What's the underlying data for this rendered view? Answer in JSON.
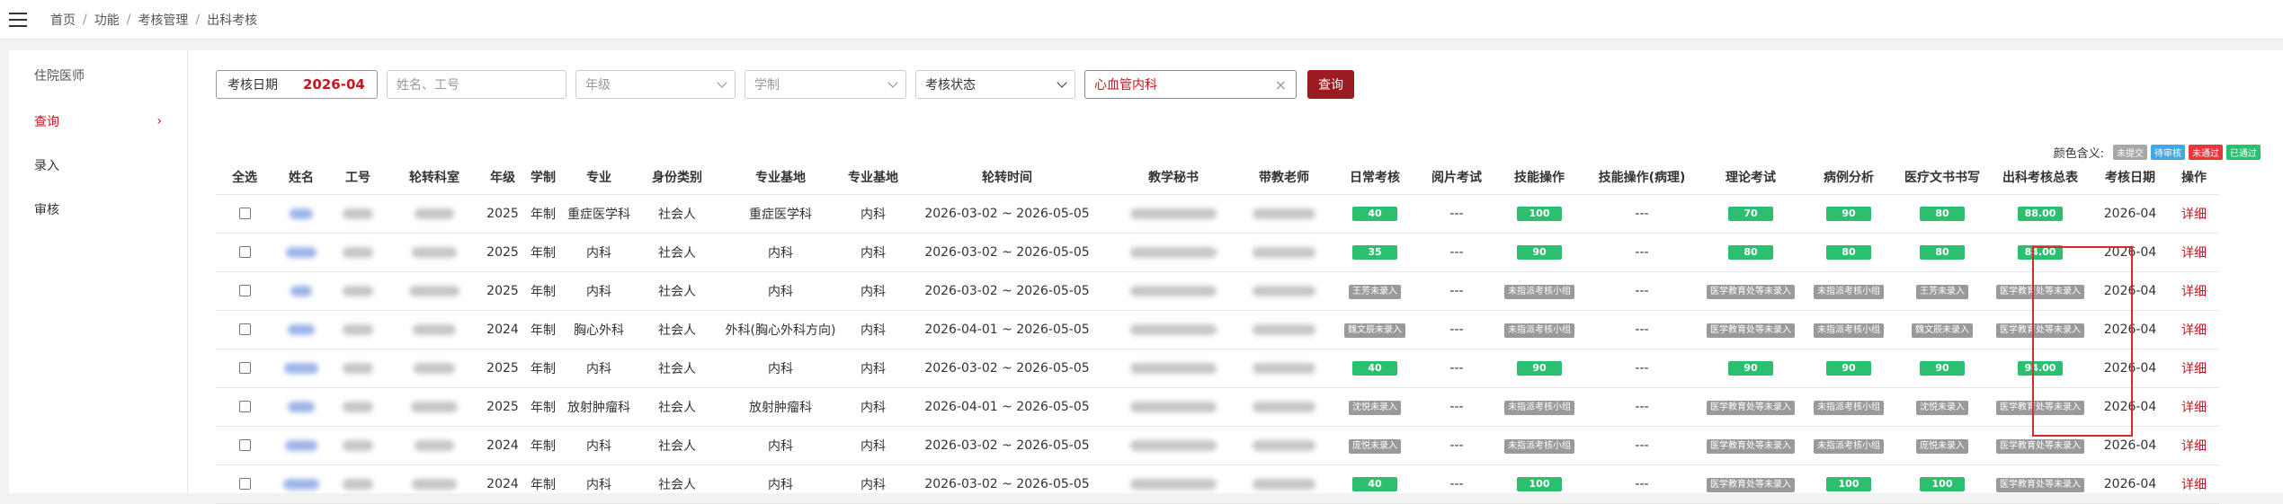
{
  "breadcrumb": [
    "首页",
    "功能",
    "考核管理",
    "出科考核"
  ],
  "sidebar": {
    "title": "住院医师",
    "items": [
      {
        "label": "查询",
        "active": true
      },
      {
        "label": "录入",
        "active": false
      },
      {
        "label": "审核",
        "active": false
      }
    ]
  },
  "filters": {
    "date_label": "考核日期",
    "date_value": "2026-04",
    "name_placeholder": "姓名、工号",
    "grade_placeholder": "年级",
    "system_placeholder": "学制",
    "status_placeholder": "考核状态",
    "department_value": "心血管内科",
    "query_button": "查询"
  },
  "legend": {
    "label": "颜色含义:",
    "tags": [
      {
        "text": "未提交",
        "color": "#a7a7a7"
      },
      {
        "text": "待审核",
        "color": "#3fa8e6"
      },
      {
        "text": "未通过",
        "color": "#e5383b"
      },
      {
        "text": "已通过",
        "color": "#2bbf6f"
      }
    ]
  },
  "table": {
    "headers": [
      "全选",
      "姓名",
      "工号",
      "轮转科室",
      "年级",
      "学制",
      "专业",
      "身份类别",
      "专业基地",
      "专业基地",
      "轮转时间",
      "教学秘书",
      "带教老师",
      "日常考核",
      "阅片考试",
      "技能操作",
      "技能操作(病理)",
      "理论考试",
      "病例分析",
      "医疗文书书写",
      "出科考核总表",
      "考核日期",
      "操作"
    ],
    "rows": [
      {
        "grade": "2025",
        "system": "年制",
        "major": "重症医学科",
        "identity": "社会人",
        "base1": "重症医学科",
        "base2": "内科",
        "period": "2026-03-02 ~ 2026-05-05",
        "daily": {
          "text": "40",
          "type": "green"
        },
        "reading": "---",
        "skill": {
          "text": "100",
          "type": "green"
        },
        "skill_path": "---",
        "theory": {
          "text": "70",
          "type": "green"
        },
        "case": {
          "text": "90",
          "type": "green"
        },
        "doc": {
          "text": "80",
          "type": "green"
        },
        "total": {
          "text": "88.00",
          "type": "green"
        },
        "date": "2026-04",
        "action": "详细"
      },
      {
        "grade": "2025",
        "system": "年制",
        "major": "内科",
        "identity": "社会人",
        "base1": "内科",
        "base2": "内科",
        "period": "2026-03-02 ~ 2026-05-05",
        "daily": {
          "text": "35",
          "type": "green"
        },
        "reading": "---",
        "skill": {
          "text": "90",
          "type": "green"
        },
        "skill_path": "---",
        "theory": {
          "text": "80",
          "type": "green"
        },
        "case": {
          "text": "80",
          "type": "green"
        },
        "doc": {
          "text": "80",
          "type": "green"
        },
        "total": {
          "text": "84.00",
          "type": "green"
        },
        "date": "2026-04",
        "action": "详细"
      },
      {
        "grade": "2025",
        "system": "年制",
        "major": "内科",
        "identity": "社会人",
        "base1": "内科",
        "base2": "内科",
        "period": "2026-03-02 ~ 2026-05-05",
        "daily": {
          "text": "王芳未录入",
          "type": "gray"
        },
        "reading": "---",
        "skill": {
          "text": "未指派考核小组",
          "type": "gray"
        },
        "skill_path": "---",
        "theory": {
          "text": "医学教育处等未录入",
          "type": "gray"
        },
        "case": {
          "text": "未指派考核小组",
          "type": "gray"
        },
        "doc": {
          "text": "王芳未录入",
          "type": "gray"
        },
        "total": {
          "text": "医学教育处等未录入",
          "type": "gray"
        },
        "date": "2026-04",
        "action": "详细"
      },
      {
        "grade": "2024",
        "system": "年制",
        "major": "胸心外科",
        "identity": "社会人",
        "base1": "外科(胸心外科方向)",
        "base2": "内科",
        "period": "2026-04-01 ~ 2026-05-05",
        "daily": {
          "text": "魏文辰未录入",
          "type": "gray"
        },
        "reading": "---",
        "skill": {
          "text": "未指派考核小组",
          "type": "gray"
        },
        "skill_path": "---",
        "theory": {
          "text": "医学教育处等未录入",
          "type": "gray"
        },
        "case": {
          "text": "未指派考核小组",
          "type": "gray"
        },
        "doc": {
          "text": "魏文辰未录入",
          "type": "gray"
        },
        "total": {
          "text": "医学教育处等未录入",
          "type": "gray"
        },
        "date": "2026-04",
        "action": "详细"
      },
      {
        "grade": "2025",
        "system": "年制",
        "major": "内科",
        "identity": "社会人",
        "base1": "内科",
        "base2": "内科",
        "period": "2026-03-02 ~ 2026-05-05",
        "daily": {
          "text": "40",
          "type": "green"
        },
        "reading": "---",
        "skill": {
          "text": "90",
          "type": "green"
        },
        "skill_path": "---",
        "theory": {
          "text": "90",
          "type": "green"
        },
        "case": {
          "text": "90",
          "type": "green"
        },
        "doc": {
          "text": "90",
          "type": "green"
        },
        "total": {
          "text": "94.00",
          "type": "green"
        },
        "date": "2026-04",
        "action": "详细"
      },
      {
        "grade": "2025",
        "system": "年制",
        "major": "放射肿瘤科",
        "identity": "社会人",
        "base1": "放射肿瘤科",
        "base2": "内科",
        "period": "2026-04-01 ~ 2026-05-05",
        "daily": {
          "text": "沈悦未录入",
          "type": "gray"
        },
        "reading": "---",
        "skill": {
          "text": "未指派考核小组",
          "type": "gray"
        },
        "skill_path": "---",
        "theory": {
          "text": "医学教育处等未录入",
          "type": "gray"
        },
        "case": {
          "text": "未指派考核小组",
          "type": "gray"
        },
        "doc": {
          "text": "沈悦未录入",
          "type": "gray"
        },
        "total": {
          "text": "医学教育处等未录入",
          "type": "gray"
        },
        "date": "2026-04",
        "action": "详细"
      },
      {
        "grade": "2024",
        "system": "年制",
        "major": "内科",
        "identity": "社会人",
        "base1": "内科",
        "base2": "内科",
        "period": "2026-03-02 ~ 2026-05-05",
        "daily": {
          "text": "庞悦未录入",
          "type": "gray"
        },
        "reading": "---",
        "skill": {
          "text": "未指派考核小组",
          "type": "gray"
        },
        "skill_path": "---",
        "theory": {
          "text": "医学教育处等未录入",
          "type": "gray"
        },
        "case": {
          "text": "未指派考核小组",
          "type": "gray"
        },
        "doc": {
          "text": "庞悦未录入",
          "type": "gray"
        },
        "total": {
          "text": "医学教育处等未录入",
          "type": "gray"
        },
        "date": "2026-04",
        "action": "详细"
      },
      {
        "grade": "2024",
        "system": "年制",
        "major": "内科",
        "identity": "社会人",
        "base1": "内科",
        "base2": "内科",
        "period": "2026-03-02 ~ 2026-05-05",
        "daily": {
          "text": "40",
          "type": "green"
        },
        "reading": "---",
        "skill": {
          "text": "100",
          "type": "green"
        },
        "skill_path": "---",
        "theory": {
          "text": "医学教育处等未录入",
          "type": "gray"
        },
        "case": {
          "text": "100",
          "type": "green"
        },
        "doc": {
          "text": "100",
          "type": "green"
        },
        "total": {
          "text": "医学教育处等未录入",
          "type": "gray"
        },
        "date": "2026-04",
        "action": "详细"
      }
    ]
  }
}
